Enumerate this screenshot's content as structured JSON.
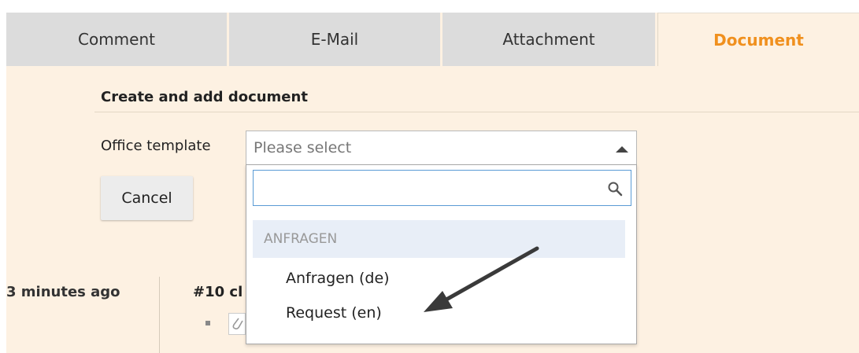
{
  "tabs": [
    {
      "label": "Comment",
      "active": false
    },
    {
      "label": "E-Mail",
      "active": false
    },
    {
      "label": "Attachment",
      "active": false
    },
    {
      "label": "Document",
      "active": true
    }
  ],
  "colors": {
    "active_tab": "#f0901e",
    "panel_bg": "#fdf1e2",
    "tab_bg": "#dcdcdc",
    "focus_border": "#5a9bd5"
  },
  "form": {
    "section_title": "Create and add document",
    "office_template": {
      "label": "Office template",
      "placeholder": "Please select",
      "expanded": true
    },
    "cancel_label": "Cancel"
  },
  "dropdown": {
    "search_value": "",
    "search_icon": "search-icon",
    "group_label": "ANFRAGEN",
    "options": [
      "Anfragen (de)",
      "Request (en)"
    ]
  },
  "timeline": {
    "time": "3 minutes ago",
    "reference": "#10 cl"
  }
}
